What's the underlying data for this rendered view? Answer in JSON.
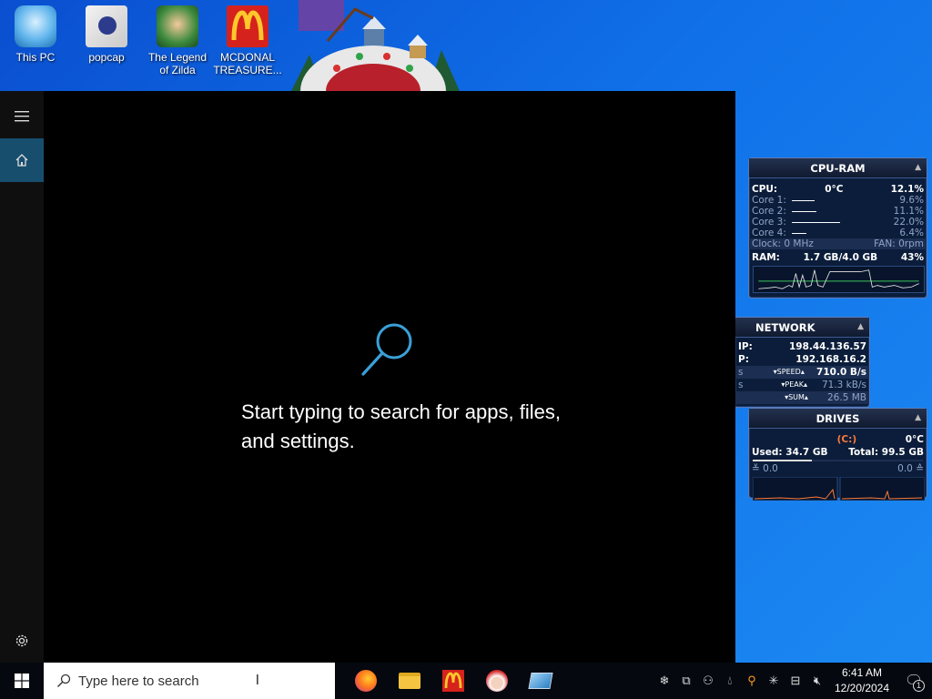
{
  "desktop": {
    "icons": [
      {
        "label": "This PC"
      },
      {
        "label": "popcap"
      },
      {
        "label_line1": "The Legend",
        "label_line2": "of Zilda"
      },
      {
        "label_line1": "MCDONAL",
        "label_line2": "TREASURE..."
      }
    ]
  },
  "search_panel": {
    "hint": "Start typing to search for apps, files, and settings."
  },
  "cpu_ram": {
    "title": "CPU-RAM",
    "cpu_label": "CPU:",
    "cpu_temp": "0°C",
    "cpu_pct": "12.1%",
    "cores": [
      {
        "label": "Core 1:",
        "value": "9.6%",
        "pct": 9.6
      },
      {
        "label": "Core 2:",
        "value": "11.1%",
        "pct": 11.1
      },
      {
        "label": "Core 3:",
        "value": "22.0%",
        "pct": 22.0
      },
      {
        "label": "Core 4:",
        "value": "6.4%",
        "pct": 6.4
      }
    ],
    "clock": "Clock: 0 MHz",
    "fan": "FAN: 0rpm",
    "ram_label": "RAM:",
    "ram_usage": "1.7 GB/4.0 GB",
    "ram_pct": "43%"
  },
  "network": {
    "title": "NETWORK",
    "ip_ext_label": "IP:",
    "ip_ext": "198.44.136.57",
    "ip_int_label": "P:",
    "ip_int": "192.168.16.2",
    "speed_label": "SPEED",
    "speed": "710.0 B/s",
    "peak_label": "PEAK",
    "peak": "71.3 kB/s",
    "sum_label": "SUM",
    "sum": "26.5 MB",
    "row_prefix": "s"
  },
  "drives": {
    "title": "DRIVES",
    "drive": "(C:)",
    "temp": "0°C",
    "used": "Used: 34.7 GB",
    "total": "Total: 99.5 GB",
    "read": "0.0",
    "write": "0.0"
  },
  "taskbar": {
    "search_placeholder": "Type here to search",
    "time": "6:41 AM",
    "date": "12/20/2024",
    "notification_count": "1"
  },
  "colors": {
    "desktop_blue": "#1070e8",
    "panel_black": "#000000",
    "rail_active": "#174e6e",
    "search_accent": "#3aa0d8",
    "gadget_bg": "#0b1d3a",
    "drive_orange": "#ff7a3a"
  }
}
